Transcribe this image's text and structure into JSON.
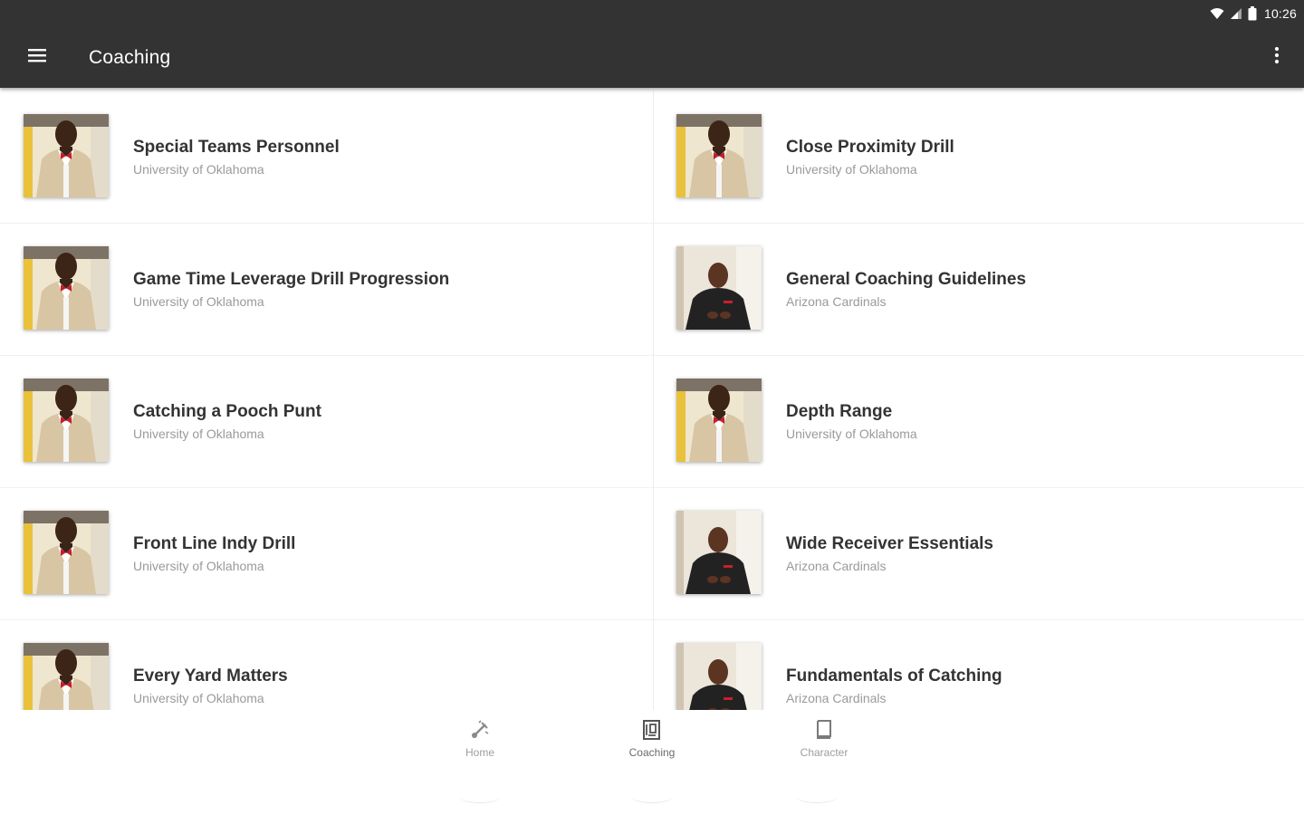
{
  "status_bar": {
    "time": "10:26",
    "icons": [
      "wifi-icon",
      "signal-icon",
      "battery-icon"
    ]
  },
  "toolbar": {
    "title": "Coaching",
    "menu_icon": "hamburger-menu-icon",
    "overflow_icon": "overflow-menu-icon",
    "background": "#333333"
  },
  "items": [
    {
      "title": "Special Teams Personnel",
      "subtitle": "University of Oklahoma",
      "thumb": "coach-oklahoma"
    },
    {
      "title": "Close Proximity Drill",
      "subtitle": "University of Oklahoma",
      "thumb": "coach-oklahoma"
    },
    {
      "title": "Game Time Leverage Drill Progression",
      "subtitle": "University of Oklahoma",
      "thumb": "coach-oklahoma"
    },
    {
      "title": "General Coaching Guidelines",
      "subtitle": "Arizona Cardinals",
      "thumb": "coach-cardinals"
    },
    {
      "title": "Catching a Pooch Punt",
      "subtitle": "University of Oklahoma",
      "thumb": "coach-oklahoma"
    },
    {
      "title": "Depth Range",
      "subtitle": "University of Oklahoma",
      "thumb": "coach-oklahoma"
    },
    {
      "title": "Front Line Indy Drill",
      "subtitle": "University of Oklahoma",
      "thumb": "coach-oklahoma"
    },
    {
      "title": "Wide Receiver Essentials",
      "subtitle": "Arizona Cardinals",
      "thumb": "coach-cardinals"
    },
    {
      "title": "Every Yard Matters",
      "subtitle": "University of Oklahoma",
      "thumb": "coach-oklahoma"
    },
    {
      "title": "Fundamentals of Catching",
      "subtitle": "Arizona Cardinals",
      "thumb": "coach-cardinals"
    }
  ],
  "bottom_nav": {
    "items": [
      {
        "label": "Home",
        "icon": "whistle-icon",
        "active": false
      },
      {
        "label": "Coaching",
        "icon": "playbook-icon",
        "active": true
      },
      {
        "label": "Character",
        "icon": "book-icon",
        "active": false
      }
    ]
  },
  "colors": {
    "title_text": "#333333",
    "subtitle_text": "#9a9a9a",
    "nav_label": "#9e9e9e"
  }
}
